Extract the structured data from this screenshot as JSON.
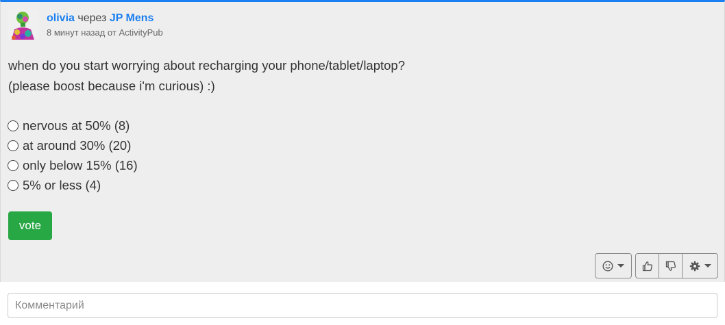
{
  "post": {
    "author": "olivia",
    "via_text": "через",
    "via_account": "JP Mens",
    "time_source": "8 минут назад от ActivityPub",
    "content_line1": "when do you start worrying about recharging your phone/tablet/laptop?",
    "content_line2": "(please boost because i'm curious) :)"
  },
  "poll": {
    "options": [
      "nervous at 50% (8)",
      "at around 30% (20)",
      "only below 15% (16)",
      "5% or less (4)"
    ],
    "vote_label": "vote"
  },
  "actions": {
    "emoji_icon": "smiley-icon",
    "like_icon": "thumbs-up-icon",
    "dislike_icon": "thumbs-down-icon",
    "settings_icon": "gear-icon"
  },
  "comment": {
    "placeholder": "Комментарий"
  },
  "colors": {
    "accent": "#1a7ff0",
    "vote_button": "#28a745",
    "card_background": "#eeeeee"
  }
}
